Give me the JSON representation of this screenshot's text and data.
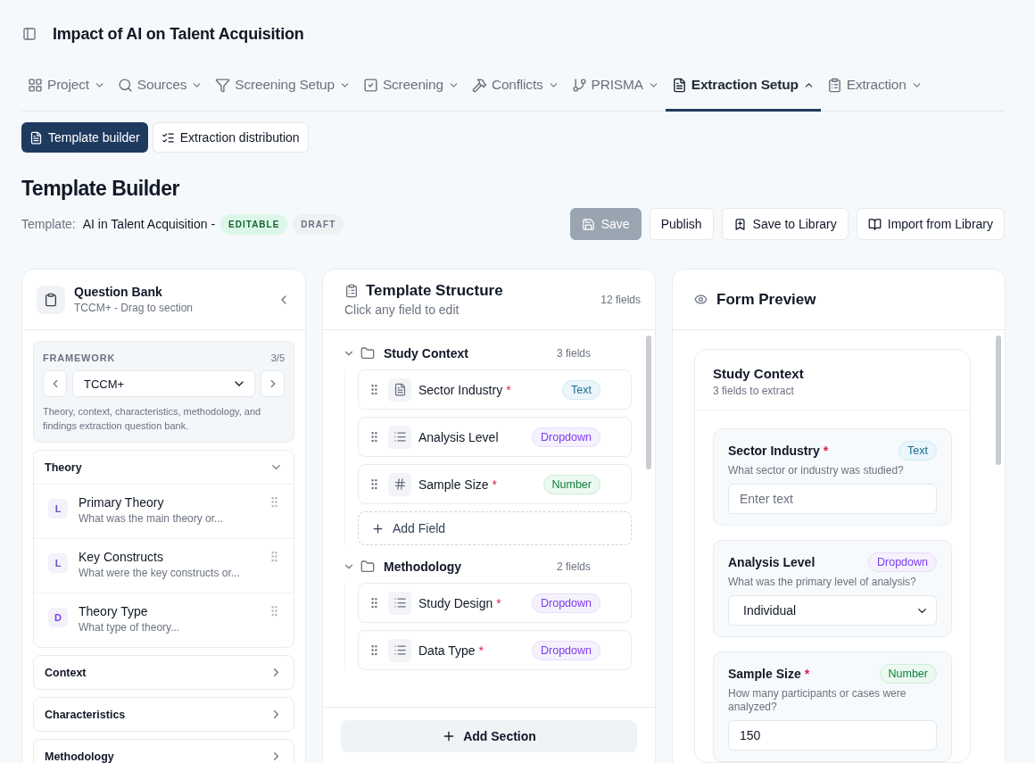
{
  "header": {
    "title": "Impact of AI on Talent Acquisition"
  },
  "nav": [
    {
      "label": "Project",
      "selected": false,
      "expanded": false
    },
    {
      "label": "Sources",
      "selected": false,
      "expanded": false
    },
    {
      "label": "Screening Setup",
      "selected": false,
      "expanded": false
    },
    {
      "label": "Screening",
      "selected": false,
      "expanded": false
    },
    {
      "label": "Conflicts",
      "selected": false,
      "expanded": false
    },
    {
      "label": "PRISMA",
      "selected": false,
      "expanded": false
    },
    {
      "label": "Extraction Setup",
      "selected": true,
      "expanded": true
    },
    {
      "label": "Extraction",
      "selected": false,
      "expanded": false
    }
  ],
  "subtabs": [
    {
      "label": "Template builder",
      "selected": true
    },
    {
      "label": "Extraction distribution",
      "selected": false
    }
  ],
  "page": {
    "title": "Template Builder",
    "template_label": "Template:",
    "template_name": "AI in Talent Acquisition -",
    "badges": [
      {
        "label": "EDITABLE",
        "kind": "editable"
      },
      {
        "label": "DRAFT",
        "kind": "draft"
      }
    ]
  },
  "actions": [
    {
      "label": "Save",
      "disabled": true
    },
    {
      "label": "Publish",
      "disabled": false
    },
    {
      "label": "Save to Library",
      "disabled": false
    },
    {
      "label": "Import from Library",
      "disabled": false
    }
  ],
  "question_bank": {
    "title": "Question Bank",
    "subtitle": "TCCM+ - Drag to section",
    "framework": {
      "label": "FRAMEWORK",
      "count": "3/5",
      "value": "TCCM+",
      "description": "Theory, context, characteristics, methodology, and findings extraction question bank."
    },
    "groups": [
      {
        "title": "Theory",
        "expanded": true,
        "items": [
          {
            "letter": "L",
            "title": "Primary Theory",
            "question": "What was the main theory or..."
          },
          {
            "letter": "L",
            "title": "Key Constructs",
            "question": "What were the key constructs or..."
          },
          {
            "letter": "D",
            "title": "Theory Type",
            "question": "What type of theory..."
          }
        ]
      },
      {
        "title": "Context",
        "expanded": false
      },
      {
        "title": "Characteristics",
        "expanded": false
      },
      {
        "title": "Methodology",
        "expanded": false
      }
    ]
  },
  "structure": {
    "title": "Template Structure",
    "subtitle": "Click any field to edit",
    "count": "12 fields",
    "sections": [
      {
        "title": "Study Context",
        "count": "3 fields",
        "expanded": true,
        "add_label": "Add Field",
        "fields": [
          {
            "name": "Sector Industry",
            "required_mark": "*",
            "kind": "text",
            "type_label": "Text"
          },
          {
            "name": "Analysis Level",
            "kind": "dropdown",
            "type_label": "Dropdown"
          },
          {
            "name": "Sample Size",
            "required_mark": "*",
            "kind": "number",
            "type_label": "Number"
          }
        ]
      },
      {
        "title": "Methodology",
        "count": "2 fields",
        "expanded": true,
        "fields": [
          {
            "name": "Study Design",
            "required_mark": "*",
            "kind": "dropdown",
            "type_label": "Dropdown"
          },
          {
            "name": "Data Type",
            "required_mark": "*",
            "kind": "dropdown",
            "type_label": "Dropdown"
          }
        ]
      }
    ],
    "add_section": "Add Section"
  },
  "preview": {
    "title": "Form Preview",
    "section": {
      "title": "Study Context",
      "subtitle": "3 fields to extract",
      "fields": [
        {
          "name": "Sector Industry",
          "required_mark": "*",
          "kind": "text",
          "type_label": "Text",
          "question": "What sector or industry was studied?",
          "placeholder": "Enter text"
        },
        {
          "name": "Analysis Level",
          "kind": "dropdown",
          "type_label": "Dropdown",
          "question": "What was the primary level of analysis?",
          "value": "Individual"
        },
        {
          "name": "Sample Size",
          "required_mark": "*",
          "kind": "number",
          "type_label": "Number",
          "question": "How many participants or cases were analyzed?",
          "value": "150"
        }
      ]
    }
  }
}
